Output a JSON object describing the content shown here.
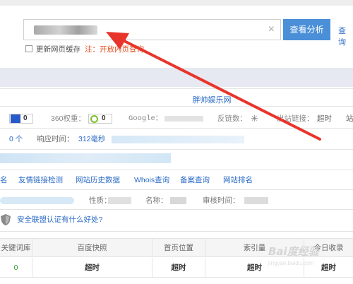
{
  "search": {
    "value": "",
    "analyze_label": "查看分析",
    "query_label": "查询"
  },
  "cache": {
    "label": "更新网页缓存",
    "note": "注：开放内页查询"
  },
  "site": {
    "title": "胖帅娱乐网"
  },
  "metrics": {
    "baidu_weight": "0",
    "q360_label": "360权重：",
    "q360_value": "0",
    "google_label": "Google：",
    "backlinks_label": "反链数：",
    "outlinks_label": "出站链接：",
    "outlinks_value": "超时",
    "trailing_value": "站"
  },
  "response": {
    "count": "0 个",
    "label": "响应时间：",
    "value": "312毫秒"
  },
  "tools": [
    "名",
    "友情链接检测",
    "网站历史数据",
    "Whois查询",
    "备案查询",
    "网站排名"
  ],
  "info": {
    "nature_label": "性质：",
    "name_label": "名称：",
    "audit_label": "审核时间："
  },
  "safety": {
    "link": "安全联盟认证有什么好处?"
  },
  "table": {
    "headers": [
      "关键词库",
      "百度快照",
      "首页位置",
      "索引量",
      "今日收录"
    ],
    "row": [
      "0",
      "超时",
      "超时",
      "超时",
      "超时"
    ]
  },
  "watermark": {
    "main": "Bai度经验",
    "sub": "jingyan.baidu.com"
  },
  "colors": {
    "accent": "#4a8fd8",
    "link": "#2b6bc7",
    "note": "#e04a1a",
    "arrow": "#e8352b"
  }
}
